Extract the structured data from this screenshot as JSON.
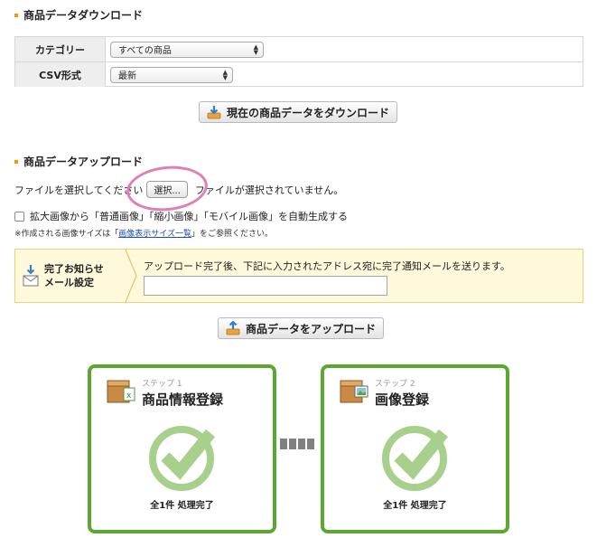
{
  "download": {
    "title": "商品データダウンロード",
    "category_label": "カテゴリー",
    "category_value": "すべての商品",
    "csv_label": "CSV形式",
    "csv_value": "最新",
    "button_label": "現在の商品データをダウンロード"
  },
  "upload": {
    "title": "商品データアップロード",
    "file_prompt": "ファイルを選択してください",
    "choose_button": "選択...",
    "file_status": "ファイルが選択されていません。",
    "auto_generate_label": "拡大画像から「普通画像」「縮小画像」「モバイル画像」を自動生成する",
    "note_prefix": "※作成される画像サイズは「",
    "note_link": "画像表示サイズ一覧",
    "note_suffix": "」をご参照ください。",
    "button_label": "商品データをアップロード"
  },
  "mail": {
    "label_line1": "完了お知らせ",
    "label_line2": "メール設定",
    "description": "アップロード完了後、下記に入力されたアドレス宛に完了通知メールを送ります。",
    "input_value": ""
  },
  "steps": [
    {
      "label": "ステップ 1",
      "title": "商品情報登録",
      "status": "全1件 処理完了"
    },
    {
      "label": "ステップ 2",
      "title": "画像登録",
      "status": "全1件 処理完了"
    }
  ],
  "colors": {
    "accent_orange": "#f39800",
    "step_green": "#5aa832",
    "check_green": "#a8d08d",
    "mail_bg": "#fff9dc",
    "highlight_pink": "#e07fb2"
  }
}
